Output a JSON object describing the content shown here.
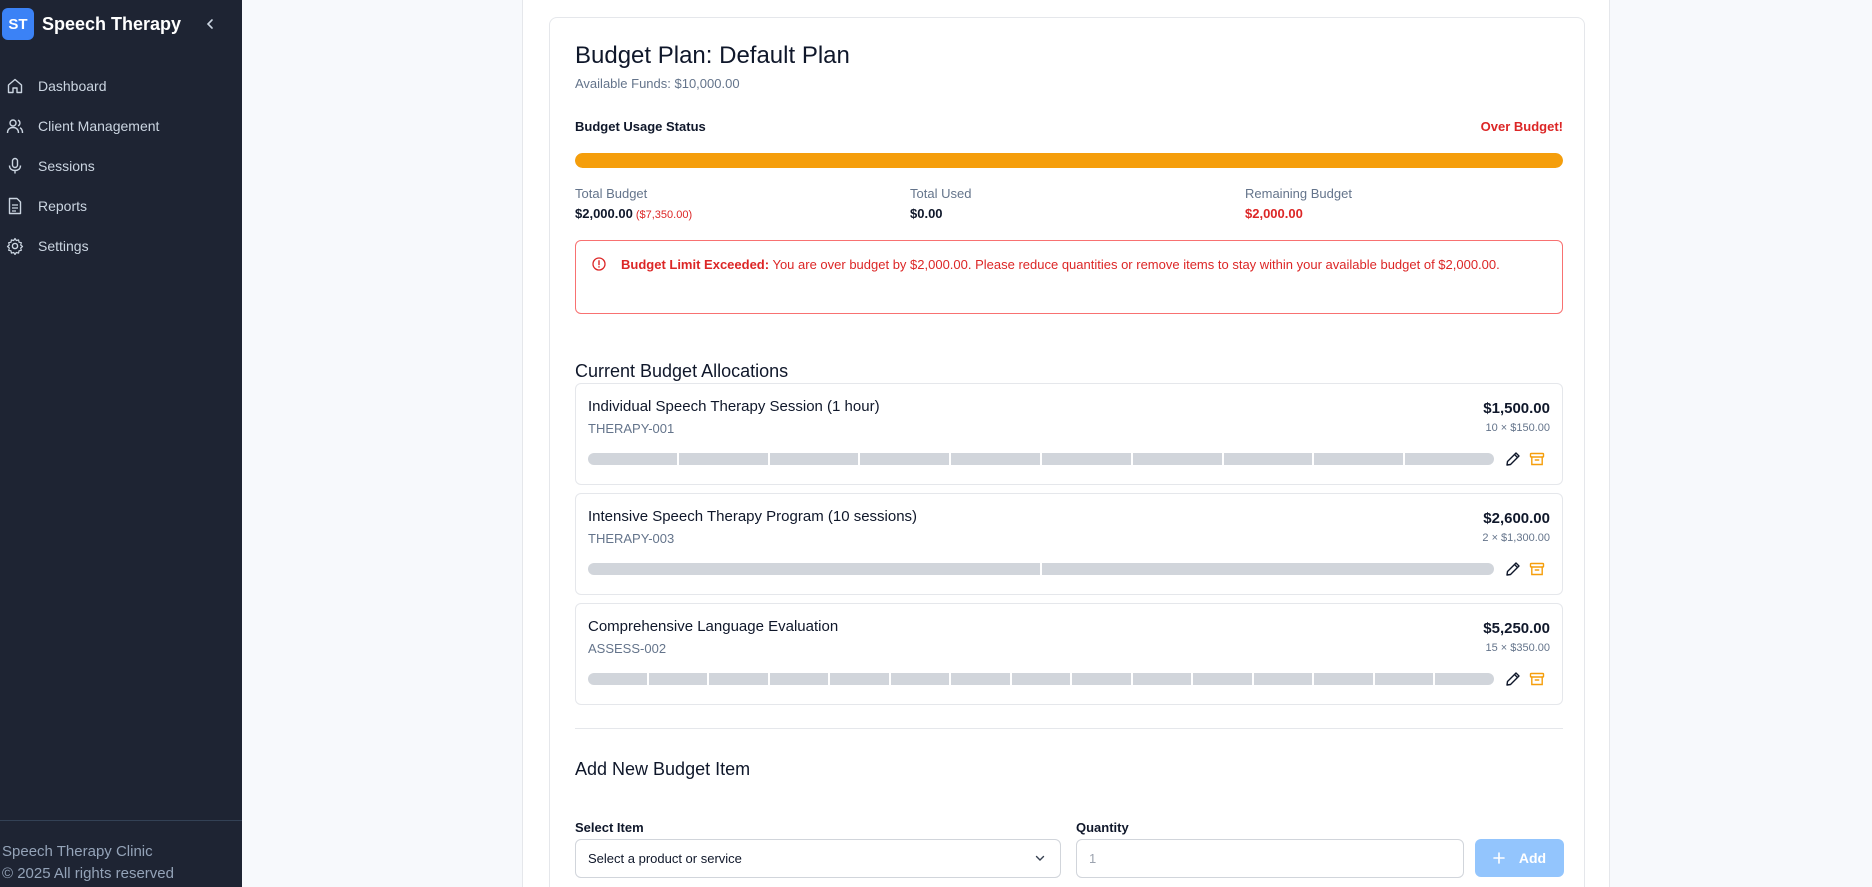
{
  "sidebar": {
    "logo_text": "ST",
    "title": "Speech Therapy",
    "items": [
      {
        "label": "Dashboard",
        "icon": "home-icon"
      },
      {
        "label": "Client Management",
        "icon": "users-icon"
      },
      {
        "label": "Sessions",
        "icon": "microphone-icon"
      },
      {
        "label": "Reports",
        "icon": "document-icon"
      },
      {
        "label": "Settings",
        "icon": "gear-icon"
      }
    ],
    "footer": {
      "org": "Speech Therapy Clinic",
      "copyright": "© 2025 All rights reserved"
    }
  },
  "plan": {
    "title": "Budget Plan: Default Plan",
    "available_funds": "Available Funds: $10,000.00"
  },
  "usage": {
    "label": "Budget Usage Status",
    "status": "Over Budget!",
    "fill_fraction": 1.0,
    "bar_color": "#f59e0b"
  },
  "stats": {
    "total_budget_label": "Total Budget",
    "total_budget_value": "$2,000.00",
    "total_budget_sub": "($7,350.00)",
    "total_used_label": "Total Used",
    "total_used_value": "$0.00",
    "remaining_label": "Remaining Budget",
    "remaining_value": "$2,000.00"
  },
  "alert": {
    "title": "Budget Limit Exceeded:",
    "message": "You are over budget by $2,000.00. Please reduce quantities or remove items to stay within your available budget of $2,000.00."
  },
  "allocations": {
    "heading": "Current Budget Allocations",
    "items": [
      {
        "name": "Individual Speech Therapy Session (1 hour)",
        "code": "THERAPY-001",
        "total": "$1,500.00",
        "calc": "10 × $150.00",
        "quantity": 10
      },
      {
        "name": "Intensive Speech Therapy Program (10 sessions)",
        "code": "THERAPY-003",
        "total": "$2,600.00",
        "calc": "2 × $1,300.00",
        "quantity": 2
      },
      {
        "name": "Comprehensive Language Evaluation",
        "code": "ASSESS-002",
        "total": "$5,250.00",
        "calc": "15 × $350.00",
        "quantity": 15
      }
    ]
  },
  "add_item": {
    "heading": "Add New Budget Item",
    "select_label": "Select Item",
    "select_value": "Select a product or service",
    "quantity_label": "Quantity",
    "quantity_placeholder": "1",
    "add_label": "Add"
  },
  "colors": {
    "sidebar_bg": "#1e2433",
    "accent": "#3b82f6",
    "danger": "#dc2626",
    "warning": "#f59e0b"
  }
}
